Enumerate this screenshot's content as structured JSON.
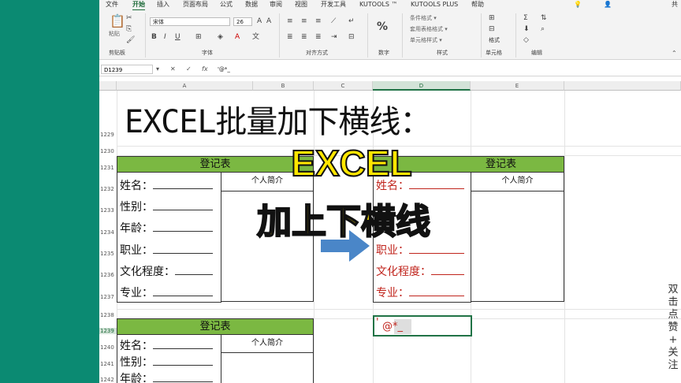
{
  "ribbon": {
    "tabs": [
      "文件",
      "开始",
      "插入",
      "页面布局",
      "公式",
      "数据",
      "审阅",
      "视图",
      "开发工具",
      "KUTOOLS ™",
      "KUTOOLS PLUS",
      "帮助"
    ],
    "font_name": "宋体",
    "font_size": "26",
    "groups": {
      "clipboard": "剪贴板",
      "font": "字体",
      "align": "对齐方式",
      "number": "数字",
      "styles": "样式",
      "cells": "单元格",
      "edit": "编辑"
    },
    "paste_label": "粘贴",
    "number_label": "%",
    "style_items": [
      "条件格式 ▾",
      "套用表格格式 ▾",
      "单元格样式 ▾"
    ],
    "cells_label": "格式",
    "share_label": "共"
  },
  "formula_bar": {
    "name_box": "D1239",
    "content": "'@*_"
  },
  "columns": [
    "A",
    "B",
    "C",
    "D",
    "E"
  ],
  "rows": [
    "1229",
    "1230",
    "1231",
    "1232",
    "1233",
    "1234",
    "1235",
    "1236",
    "1237",
    "1238",
    "1239",
    "1240",
    "1241",
    "1242"
  ],
  "sheet": {
    "title": "EXCEL批量加下横线：",
    "table_header": "登记表",
    "intro_label": "个人简介",
    "fields": [
      "姓名：",
      "性别：",
      "年龄：",
      "职业：",
      "文化程度：",
      "专业："
    ],
    "edit_prefix": "'",
    "edit_value": "@*_"
  },
  "overlay": {
    "line1": "EXCEL",
    "line2": "加上下横线"
  },
  "side_text": [
    "双",
    "击",
    "点",
    "赞",
    "+",
    "关",
    "注"
  ],
  "colors": {
    "background": "#0b8a72",
    "header_green": "#7bb842",
    "red_text": "#c0241c",
    "overlay_yellow": "#ffe600",
    "arrow_blue": "#4a86c8"
  }
}
